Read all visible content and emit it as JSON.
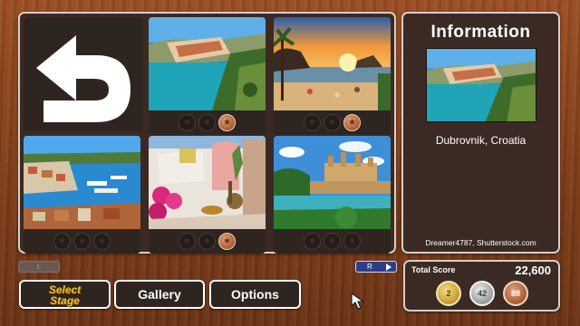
{
  "stage_grid": {
    "back_icon": "return-arrow-icon",
    "tiles": [
      {
        "scene": "coastal old town with cliffs and turquoise bay",
        "medals": [
          "empty",
          "empty",
          "bronze"
        ]
      },
      {
        "scene": "beach sunset with palm and rocky island",
        "medals": [
          "empty",
          "empty",
          "bronze"
        ]
      },
      {
        "scene": "harbor town with yachts",
        "medals": [
          "empty",
          "empty",
          "empty"
        ]
      },
      {
        "scene": "white houses with pink flowers",
        "medals": [
          "empty",
          "empty",
          "bronze"
        ]
      },
      {
        "scene": "cathedral by the sea",
        "medals": [
          "empty",
          "empty",
          "empty"
        ]
      }
    ],
    "colors": {
      "earned_medal": "#a9592f",
      "empty_medal": "#241c18"
    }
  },
  "info": {
    "title": "Information",
    "location": "Dubrovnik, Croatia",
    "credit": "Dreamer4787, Shutterstock.com"
  },
  "shoulder": {
    "left_label": "L",
    "right_label": "R"
  },
  "menu": {
    "select_stage_line1": "Select",
    "select_stage_line2": "Stage",
    "gallery": "Gallery",
    "options": "Options"
  },
  "score": {
    "label": "Total Score",
    "value": "22,600",
    "gold_count": "2",
    "silver_count": "42",
    "bronze_count": "88"
  },
  "colors": {
    "panel": "#3a2a23",
    "accent_gold": "#f2c233",
    "r_button": "#2c3e8a"
  }
}
